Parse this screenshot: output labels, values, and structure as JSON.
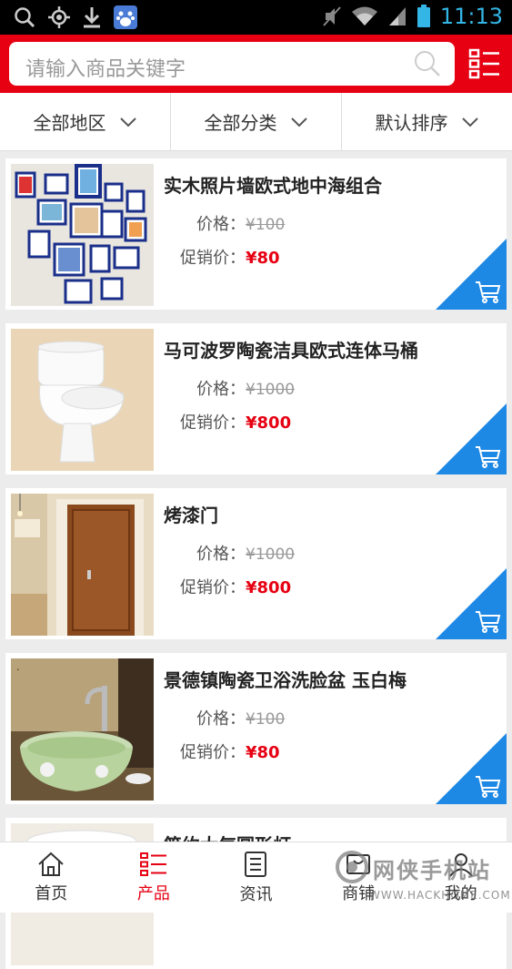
{
  "status_bar": {
    "time": "11:13"
  },
  "search": {
    "placeholder": "请输入商品关键字"
  },
  "filters": [
    {
      "label": "全部地区"
    },
    {
      "label": "全部分类"
    },
    {
      "label": "默认排序"
    }
  ],
  "products": [
    {
      "title": "实木照片墙欧式地中海组合",
      "price_label": "价格：",
      "old_price": "¥100",
      "promo_label": "促销价：",
      "promo_price": "¥80"
    },
    {
      "title": "马可波罗陶瓷洁具欧式连体马桶",
      "price_label": "价格：",
      "old_price": "¥1000",
      "promo_label": "促销价：",
      "promo_price": "¥800"
    },
    {
      "title": "烤漆门",
      "price_label": "价格：",
      "old_price": "¥1000",
      "promo_label": "促销价：",
      "promo_price": "¥800"
    },
    {
      "title": "景德镇陶瓷卫浴洗脸盆 玉白梅",
      "price_label": "价格：",
      "old_price": "¥100",
      "promo_label": "促销价：",
      "promo_price": "¥80"
    },
    {
      "title": "简约大气圆形灯"
    }
  ],
  "tabs": [
    {
      "label": "首页",
      "icon": "home-icon"
    },
    {
      "label": "产品",
      "icon": "list-icon",
      "active": true
    },
    {
      "label": "资讯",
      "icon": "news-icon"
    },
    {
      "label": "商铺",
      "icon": "shop-icon"
    },
    {
      "label": "我的",
      "icon": "user-icon"
    }
  ],
  "watermark": {
    "text": "网侠手机站",
    "url": "WWW.HACKHOME.COM"
  },
  "colors": {
    "brand_red": "#e60012",
    "cart_blue": "#1e88e5",
    "status_blue": "#33b5e5"
  }
}
